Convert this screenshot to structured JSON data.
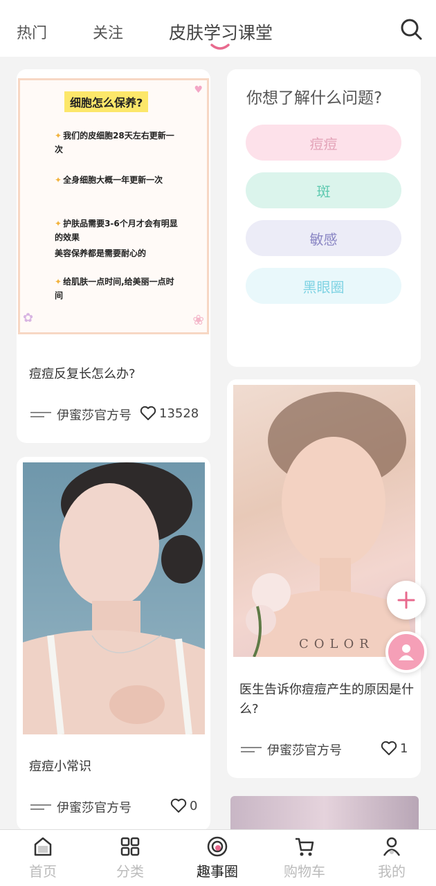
{
  "tabs": [
    {
      "label": "热门"
    },
    {
      "label": "关注"
    },
    {
      "label": "皮肤学习课堂"
    }
  ],
  "accent_color": "#e86a8e",
  "poster": {
    "title": "细胞怎么保养?",
    "lines": [
      "我们的皮细胞28天左右更新一次",
      "全身细胞大概一年更新一次",
      "护肤品需要3-6个月才会有明显的效果",
      "美容保养都是需要耐心的",
      "给肌肤一点时间,给美丽一点时间"
    ]
  },
  "cards": [
    {
      "title": "痘痘反复长怎么办?",
      "author": "伊蜜莎官方号",
      "likes": "13528"
    },
    {
      "title": "医生告诉你痘痘产生的原因是什么?",
      "author": "伊蜜莎官方号",
      "likes": "1"
    },
    {
      "title": "痘痘小常识",
      "author": "伊蜜莎官方号",
      "likes": "0"
    }
  ],
  "photo_caption": "COLOR",
  "question_panel": {
    "title": "你想了解什么问题?",
    "options": [
      {
        "label": "痘痘",
        "bg": "#fde1ea",
        "fg": "#e3a3b8"
      },
      {
        "label": "斑",
        "bg": "#dbf4ec",
        "fg": "#5ec9b0"
      },
      {
        "label": "敏感",
        "bg": "#ececf7",
        "fg": "#8a86c4"
      },
      {
        "label": "黑眼圈",
        "bg": "#e9f8fb",
        "fg": "#7fd3e3"
      }
    ]
  },
  "nav": [
    {
      "label": "首页",
      "icon": "home-icon"
    },
    {
      "label": "分类",
      "icon": "grid-icon"
    },
    {
      "label": "趣事圈",
      "icon": "circle-icon"
    },
    {
      "label": "购物车",
      "icon": "cart-icon"
    },
    {
      "label": "我的",
      "icon": "user-icon"
    }
  ]
}
